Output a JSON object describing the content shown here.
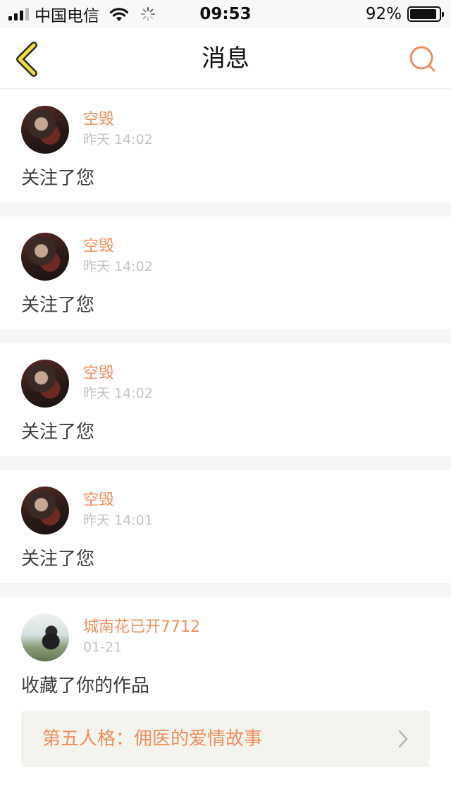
{
  "status_bar": {
    "carrier": "中国电信",
    "time": "09:53",
    "battery_percent": "92%",
    "battery_level": 0.92
  },
  "nav": {
    "title": "消息",
    "back_icon": "back-chevron-icon",
    "search_icon": "search-icon",
    "accent_color": "#ef8e5a"
  },
  "messages": [
    {
      "username": "空毁",
      "time": "昨天 14:02",
      "action": "关注了您"
    },
    {
      "username": "空毁",
      "time": "昨天 14:02",
      "action": "关注了您"
    },
    {
      "username": "空毁",
      "time": "昨天 14:02",
      "action": "关注了您"
    },
    {
      "username": "空毁",
      "time": "昨天 14:01",
      "action": "关注了您"
    },
    {
      "username": "城南花已开7712",
      "time": "01-21",
      "action": "收藏了你的作品",
      "work_title": "第五人格：佣医的爱情故事"
    }
  ]
}
